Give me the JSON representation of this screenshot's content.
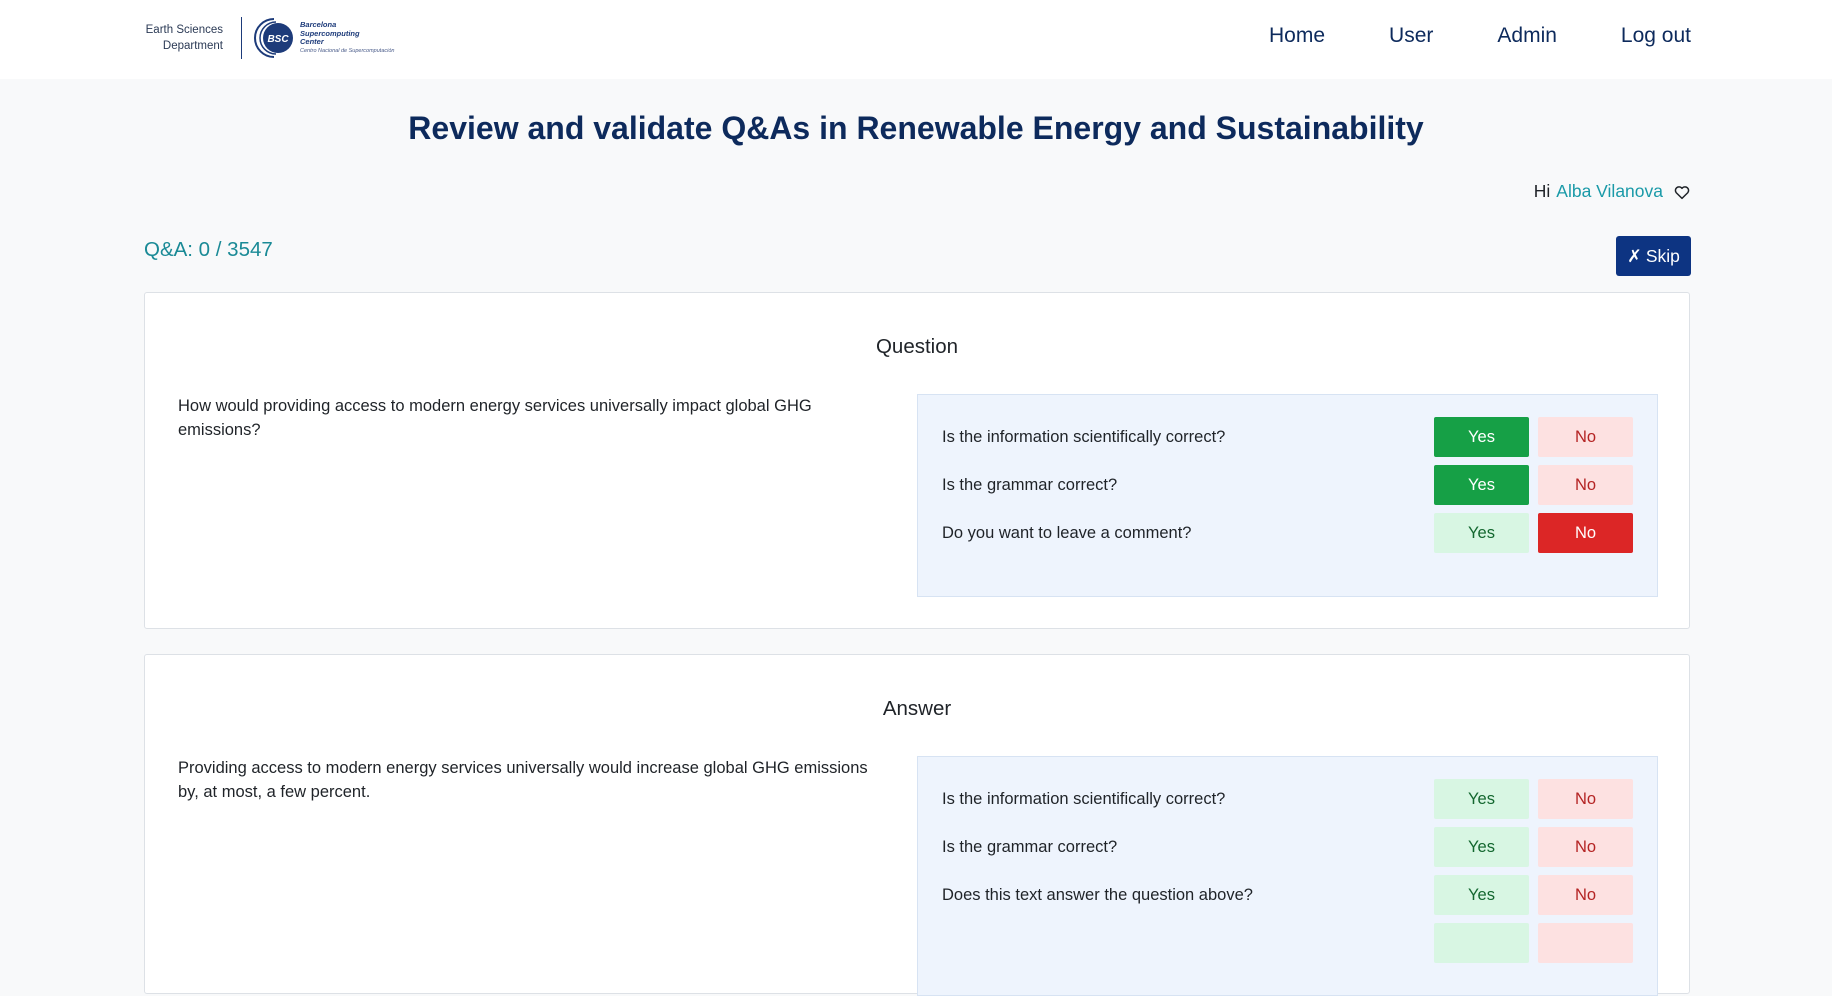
{
  "header": {
    "dept_line1": "Earth Sciences",
    "dept_line2": "Department",
    "bsc_badge": "BSC",
    "bsc_name_line1": "Barcelona",
    "bsc_name_line2": "Supercomputing",
    "bsc_name_line3": "Center",
    "bsc_tagline": "Centro Nacional de Supercomputación",
    "nav": [
      "Home",
      "User",
      "Admin",
      "Log out"
    ]
  },
  "title": "Review and validate Q&As in Renewable Energy and Sustainability",
  "greeting": {
    "prefix": "Hi",
    "user": "Alba Vilanova"
  },
  "progress": {
    "text": "Q&A: 0 / 3547"
  },
  "skip": {
    "icon": "✗",
    "label": "Skip"
  },
  "question": {
    "title": "Question",
    "text": "How would providing access to modern energy services universally impact global GHG emissions?",
    "checks": [
      {
        "label": "Is the information scientifically correct?",
        "yes": "Yes",
        "no": "No",
        "selected": "yes"
      },
      {
        "label": "Is the grammar correct?",
        "yes": "Yes",
        "no": "No",
        "selected": "yes"
      },
      {
        "label": "Do you want to leave a comment?",
        "yes": "Yes",
        "no": "No",
        "selected": "no"
      }
    ]
  },
  "answer": {
    "title": "Answer",
    "text": "Providing access to modern energy services universally would increase global GHG emissions by, at most, a few percent.",
    "checks": [
      {
        "label": "Is the information scientifically correct?",
        "yes": "Yes",
        "no": "No",
        "selected": ""
      },
      {
        "label": "Is the grammar correct?",
        "yes": "Yes",
        "no": "No",
        "selected": ""
      },
      {
        "label": "Does this text answer the question above?",
        "yes": "Yes",
        "no": "No",
        "selected": ""
      },
      {
        "label": "",
        "yes": "",
        "no": "",
        "selected": ""
      }
    ]
  },
  "colors": {
    "nav": "#0d2a5c",
    "accent": "#1a9aa8",
    "skip_bg": "#0d3482",
    "yes_selected": "#16a046",
    "no_selected": "#dc2626",
    "yes_idle": "#d8f6e3",
    "no_idle": "#fde1e1",
    "panel_bg": "#eef4fd"
  }
}
